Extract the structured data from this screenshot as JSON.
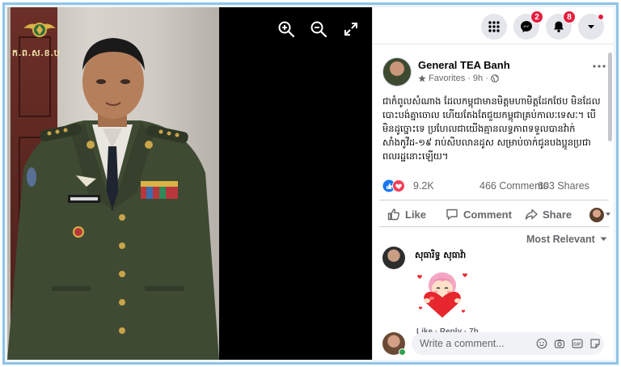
{
  "viewer": {
    "logo_text": "ក.ព.ស.ខ.ប",
    "tools": [
      "zoom-in-icon",
      "zoom-out-icon",
      "fullscreen-icon"
    ]
  },
  "topbar": {
    "buttons": [
      "menu-grid-icon",
      "messenger-icon",
      "notifications-icon",
      "account-dropdown-icon"
    ],
    "messenger_badge": "2",
    "notifications_badge": "8"
  },
  "post": {
    "author": "General TEA Banh",
    "audience": "Favorites",
    "separator": "·",
    "time": "9h",
    "separator2": "·",
    "text": "ជាកំពូលសំណាង ដែលកម្ពុជាមានមិត្តមហាមិត្តដែកថែប មិនដែលបោះបង់គ្នាចោល ហើយតែងតែជួយកម្ពុជាគ្រប់កាលៈទេសៈ។ បើមិនដូច្នោះទេ ប្រហែលជាយើងគ្មានលទ្ធភាពទទួលបានវ៉ាក់សាំងកូវីដ-១៩ រាប់សិបលានដូស សម្រាប់ចាក់ជូនបងប្អូនប្រជាពលរដ្ឋនោះឡើយ។",
    "reactions_count": "9.2K",
    "comments_count": "466 Comments",
    "shares_count": "603 Shares"
  },
  "actions": {
    "like": "Like",
    "comment": "Comment",
    "share": "Share"
  },
  "comments": {
    "sort_label": "Most Relevant",
    "items": [
      {
        "name": "សុធារិទ្ធ សុធាវ៉ា",
        "actions": "Like · Reply · 7h"
      }
    ]
  },
  "composer": {
    "placeholder": "Write a comment..."
  },
  "colors": {
    "frame_border": "#8fc3e8",
    "badge_red": "#e41e3f",
    "like_blue": "#1877f2",
    "love_red": "#f33e58",
    "online_green": "#31a24c"
  }
}
